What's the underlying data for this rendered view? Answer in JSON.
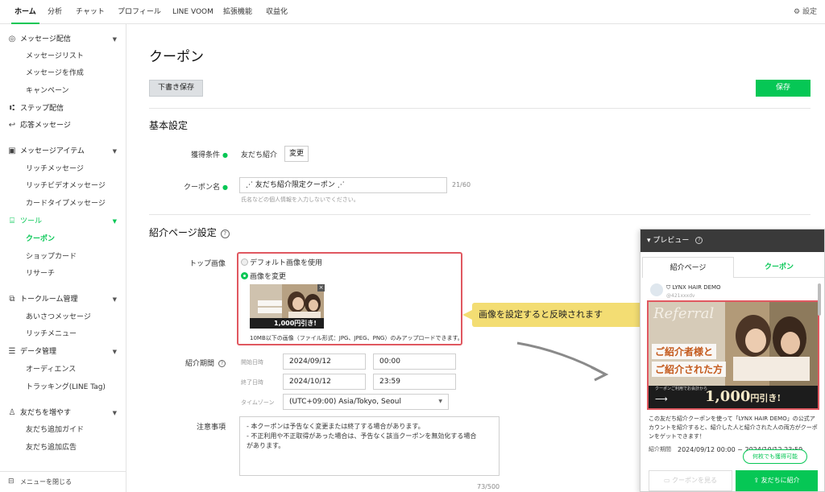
{
  "topnav": {
    "tabs": [
      "ホーム",
      "分析",
      "チャット",
      "プロフィール",
      "LINE VOOM",
      "拡張機能",
      "収益化"
    ],
    "settings": "設定"
  },
  "sidebar": {
    "sections": [
      {
        "label": "メッセージ配信",
        "icon": "megaphone-icon",
        "items": [
          "メッセージリスト",
          "メッセージを作成",
          "キャンペーン"
        ]
      },
      {
        "label": "ステップ配信",
        "icon": "step-icon",
        "items": []
      },
      {
        "label": "応答メッセージ",
        "icon": "reply-icon",
        "items": []
      },
      {
        "label": "メッセージアイテム",
        "icon": "media-icon",
        "items": [
          "リッチメッセージ",
          "リッチビデオメッセージ",
          "カードタイプメッセージ"
        ]
      },
      {
        "label": "ツール",
        "icon": "toolbox-icon",
        "items": [
          "クーポン",
          "ショップカード",
          "リサーチ"
        ]
      },
      {
        "label": "トークルーム管理",
        "icon": "chat-room-icon",
        "items": [
          "あいさつメッセージ",
          "リッチメニュー"
        ]
      },
      {
        "label": "データ管理",
        "icon": "database-icon",
        "items": [
          "オーディエンス",
          "トラッキング(LINE Tag)"
        ]
      },
      {
        "label": "友だちを増やす",
        "icon": "add-friend-icon",
        "items": [
          "友だち追加ガイド",
          "友だち追加広告"
        ]
      }
    ],
    "footer": "メニューを閉じる"
  },
  "main": {
    "title": "クーポン",
    "draft_label": "下書き保存",
    "save_label": "保存",
    "basic_title": "基本設定",
    "acq_label": "獲得条件",
    "acq_value": "友だち紹介",
    "change_label": "変更",
    "coupon_name_label": "クーポン名",
    "coupon_name_value": "⋰ 友だち紹介限定クーポン ⋰",
    "coupon_name_count": "21/60",
    "coupon_name_hint": "氏名などの個人情報を入力しないでください。",
    "intro_title": "紹介ページ設定",
    "top_image_label": "トップ画像",
    "radio_default": "デフォルト画像を使用",
    "radio_change": "画像を変更",
    "upload_hint": "10MB以下の画像（ファイル形式：JPG、JPEG、PNG）のみアップロードできます。",
    "period_label": "紹介期間",
    "start_label": "開始日時",
    "start_date": "2024/09/12",
    "start_time": "00:00",
    "end_label": "終了日時",
    "end_date": "2024/10/12",
    "end_time": "23:59",
    "tz_label": "タイムゾーン",
    "tz_value": "(UTC+09:00) Asia/Tokyo, Seoul",
    "notes_label": "注意事項",
    "notes_lines": [
      "- 本クーポンは予告なく変更または終了する場合があります。",
      "- 不正利用や不正取得があった場合は、予告なく該当クーポンを無効化する場合",
      "があります。"
    ],
    "notes_count": "73/500"
  },
  "callout": "画像を設定すると反映されます",
  "preview": {
    "header": "プレビュー",
    "tab_intro": "紹介ページ",
    "tab_coupon": "クーポン",
    "account_name": "LYNX HAIR DEMO",
    "account_id": "@421xxxdv",
    "banner_script": "Referral",
    "banner_line1": "ご紹介者様と",
    "banner_line2": "ご紹介された方",
    "banner_small": "クーポンご利用でお会計から",
    "banner_amount": "1,000",
    "banner_suffix": "円引き!",
    "desc": "この友だち紹介クーポンを使って「LYNX HAIR DEMO」の公式アカウントを紹介すると、紹介した人と紹介された人の両方がクーポンをゲットできます！",
    "period_label": "紹介期間",
    "period_value": "2024/09/12 00:00 ~ 2024/10/12 23:59",
    "pill": "何枚でも獲得可能",
    "btn_view": "クーポンを見る",
    "btn_intro": "友だちに紹介"
  },
  "colors": {
    "accent": "#06c755",
    "highlight": "#e05860",
    "callout": "#f3dd73"
  }
}
